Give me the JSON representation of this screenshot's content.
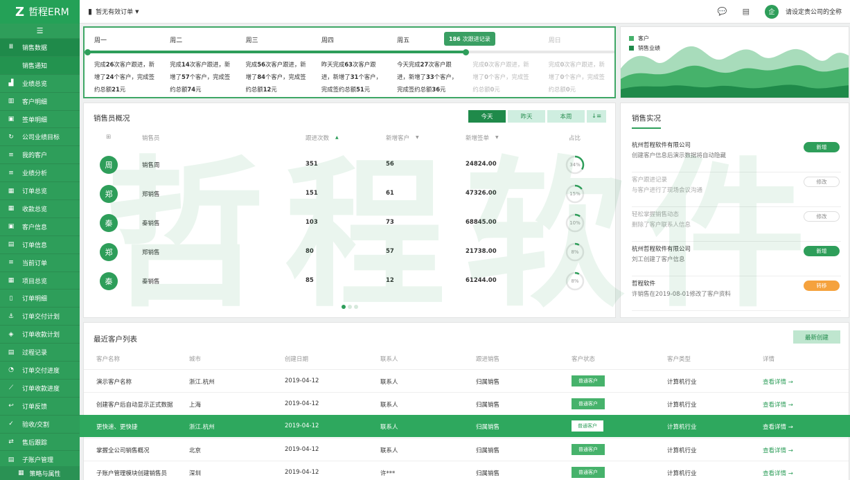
{
  "brand": {
    "logo": "Z",
    "name": "哲程ERM"
  },
  "nav": {
    "collapse_icon": "☰",
    "items": [
      {
        "label": "销售数据",
        "icon": "bar-icon"
      },
      {
        "label": "销售通知",
        "icon": ""
      },
      {
        "label": "业绩总览",
        "icon": "area-chart-icon"
      },
      {
        "label": "客户明细",
        "icon": "bar-chart-icon"
      },
      {
        "label": "签单明细",
        "icon": "contact-icon"
      },
      {
        "label": "公司业绩目标",
        "icon": "refresh-icon"
      },
      {
        "label": "我的客户",
        "icon": "list-icon"
      },
      {
        "label": "业绩分析",
        "icon": "list-icon"
      },
      {
        "label": "订单总览",
        "icon": "grid-icon"
      },
      {
        "label": "收款总览",
        "icon": "grid-icon"
      },
      {
        "label": "客户信息",
        "icon": "id-card-icon"
      },
      {
        "label": "订单信息",
        "icon": "file-icon"
      },
      {
        "label": "当前订单",
        "icon": "list-icon"
      },
      {
        "label": "项目总览",
        "icon": "grid-icon"
      },
      {
        "label": "订单明细",
        "icon": "doc-icon"
      },
      {
        "label": "订单交付计划",
        "icon": "anchor-icon"
      },
      {
        "label": "订单收款计划",
        "icon": "cube-icon"
      },
      {
        "label": "过程记录",
        "icon": "db-icon"
      },
      {
        "label": "订单交付进度",
        "icon": "pie-icon"
      },
      {
        "label": "订单收款进度",
        "icon": "line-icon"
      },
      {
        "label": "订单反馈",
        "icon": "reply-icon"
      },
      {
        "label": "验收/交割",
        "icon": "check-icon"
      },
      {
        "label": "售后跟踪",
        "icon": "sync-icon"
      },
      {
        "label": "子账户管理",
        "icon": "file-icon"
      }
    ],
    "footer": "策略与属性"
  },
  "topbar": {
    "order_hint": "暂无有效订单",
    "company_prompt": "请设定贵公司的全称",
    "avatar_text": "企"
  },
  "week": {
    "days": [
      "周一",
      "周二",
      "周三",
      "周四",
      "周五",
      "",
      "周日"
    ],
    "today_count": "186",
    "today_label": "次跟进记录",
    "progress_fraction": 0.72,
    "entries": [
      {
        "a": "完成",
        "n1": "26",
        "b": "次客户跟进，新增了",
        "n2": "24",
        "c": "个客户，完成签约总额",
        "n3": "21",
        "d": "元",
        "future": false
      },
      {
        "a": "完成",
        "n1": "14",
        "b": "次客户跟进，新增了",
        "n2": "57",
        "c": "个客户，完成签约总额",
        "n3": "74",
        "d": "元",
        "future": false
      },
      {
        "a": "完成",
        "n1": "56",
        "b": "次客户跟进，新增了",
        "n2": "84",
        "c": "个客户，完成签约总额",
        "n3": "12",
        "d": "元",
        "future": false
      },
      {
        "a": "昨天完成",
        "n1": "63",
        "b": "次客户跟进，新增了",
        "n2": "31",
        "c": "个客户，完成签约总额",
        "n3": "51",
        "d": "元",
        "future": false
      },
      {
        "a": "今天完成",
        "n1": "27",
        "b": "次客户跟进，新增了",
        "n2": "33",
        "c": "个客户，完成签约总额",
        "n3": "36",
        "d": "元",
        "future": false
      },
      {
        "a": "完成",
        "n1": "0",
        "b": "次客户跟进，新增了",
        "n2": "0",
        "c": "个客户，完成签约总额",
        "n3": "0",
        "d": "元",
        "future": true
      },
      {
        "a": "完成",
        "n1": "0",
        "b": "次客户跟进，新增了",
        "n2": "0",
        "c": "个客户，完成签约总额",
        "n3": "0",
        "d": "元",
        "future": true
      }
    ]
  },
  "legend": {
    "items": [
      {
        "label": "客户",
        "color": "#46b26b"
      },
      {
        "label": "销售业绩",
        "color": "#1f8a4a"
      }
    ]
  },
  "sales": {
    "title": "销售员概况",
    "tabs": [
      "今天",
      "昨天",
      "本周"
    ],
    "sort_icon": "↓≡",
    "columns": [
      "销售员",
      "跟进次数",
      "新增客户",
      "新增签单",
      "占比"
    ],
    "grid_icon": "⊞",
    "rows": [
      {
        "avatar": "周",
        "name": "销售周",
        "follow": "351",
        "new_cust": "56",
        "amount": "24824.00",
        "share": "34%",
        "share_value": 34
      },
      {
        "avatar": "郑",
        "name": "郑销售",
        "follow": "151",
        "new_cust": "61",
        "amount": "47326.00",
        "share": "15%",
        "share_value": 15
      },
      {
        "avatar": "秦",
        "name": "秦销售",
        "follow": "103",
        "new_cust": "73",
        "amount": "68845.00",
        "share": "10%",
        "share_value": 10
      },
      {
        "avatar": "郑",
        "name": "郑销售",
        "follow": "80",
        "new_cust": "57",
        "amount": "21738.00",
        "share": "8%",
        "share_value": 8
      },
      {
        "avatar": "秦",
        "name": "秦销售",
        "follow": "85",
        "new_cust": "12",
        "amount": "61244.00",
        "share": "8%",
        "share_value": 8
      }
    ]
  },
  "feed": {
    "title": "销售实况",
    "items": [
      {
        "title": "杭州哲程软件有限公司",
        "desc": "创建客户信息后演示数据将自动隐藏",
        "tag": "新增",
        "kind": "new",
        "muted": false
      },
      {
        "title": "客户跟进记录",
        "desc": "与客户进行了现场会议沟通",
        "tag": "修改",
        "kind": "edit",
        "muted": true
      },
      {
        "title": "轻松掌握销售动态",
        "desc": "删除了客户联系人信息",
        "tag": "修改",
        "kind": "edit",
        "muted": true
      },
      {
        "title": "杭州哲程软件有限公司",
        "desc": "刘工创建了客户信息",
        "tag": "新增",
        "kind": "new",
        "muted": false
      },
      {
        "title": "哲程软件",
        "desc": "许销售在2019-08-01修改了客户资料",
        "tag": "转移",
        "kind": "move",
        "muted": false
      }
    ]
  },
  "customers": {
    "title": "最近客户列表",
    "create_label": "最新创建",
    "columns": [
      "客户名称",
      "城市",
      "创建日期",
      "联系人",
      "跟进销售",
      "客户状态",
      "客户类型",
      "详情"
    ],
    "rows": [
      {
        "name": "演示客户名称",
        "city": "浙江.杭州",
        "date": "2019-04-12",
        "contact": "联系人",
        "sales": "归属销售",
        "status": "普通客户",
        "type": "计算机行业",
        "detail": "查看详情 →",
        "highlight": false
      },
      {
        "name": "创建客户后自动显示正式数据",
        "city": "上海",
        "date": "2019-04-12",
        "contact": "联系人",
        "sales": "归属销售",
        "status": "普通客户",
        "type": "计算机行业",
        "detail": "查看详情 →",
        "highlight": false
      },
      {
        "name": "更快速、更快捷",
        "city": "浙江.杭州",
        "date": "2019-04-12",
        "contact": "联系人",
        "sales": "归属销售",
        "status": "普通客户",
        "type": "计算机行业",
        "detail": "查看详情 →",
        "highlight": true
      },
      {
        "name": "掌握全公司销售概况",
        "city": "北京",
        "date": "2019-04-12",
        "contact": "联系人",
        "sales": "归属销售",
        "status": "普通客户",
        "type": "计算机行业",
        "detail": "查看详情 →",
        "highlight": false
      },
      {
        "name": "子账户管理模块创建销售员",
        "city": "深圳",
        "date": "2019-04-12",
        "contact": "许***",
        "sales": "归属销售",
        "status": "普通客户",
        "type": "计算机行业",
        "detail": "查看详情 →",
        "highlight": false
      }
    ]
  },
  "watermark": "哲程软件"
}
